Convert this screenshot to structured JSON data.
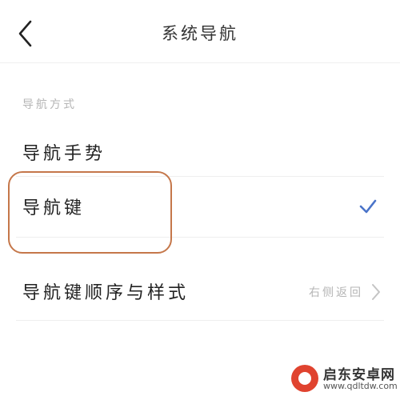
{
  "header": {
    "title": "系统导航",
    "back_icon": "chevron-left-icon"
  },
  "section": {
    "label": "导航方式"
  },
  "options": [
    {
      "label": "导航手势",
      "selected": false
    },
    {
      "label": "导航键",
      "selected": true
    }
  ],
  "settings": {
    "key_order": {
      "label": "导航键顺序与样式",
      "value": "右侧返回"
    }
  },
  "colors": {
    "checkmark": "#4a74c9",
    "highlight_border": "#c5774a",
    "watermark_logo": "#e0432f"
  },
  "watermark": {
    "title": "启东安卓网",
    "url": "www.qdltdw.com"
  }
}
